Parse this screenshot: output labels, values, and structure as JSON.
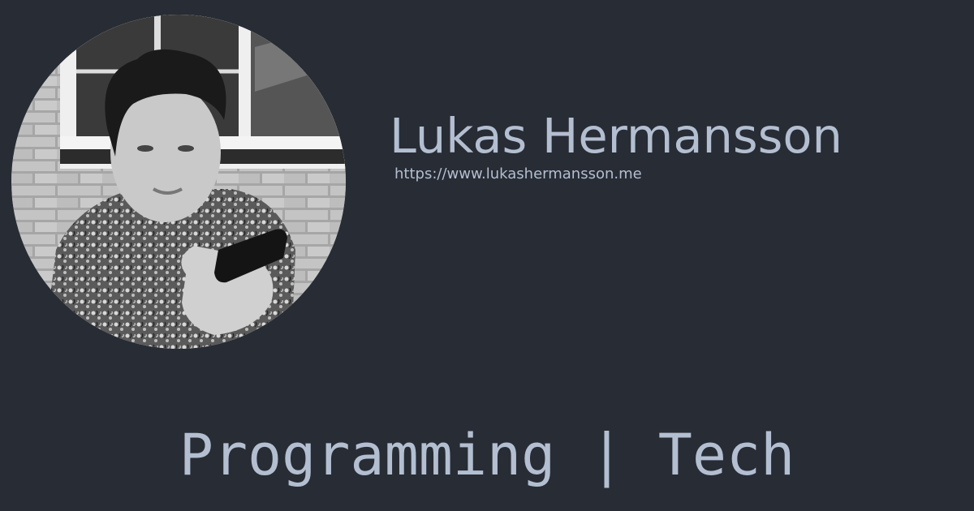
{
  "profile": {
    "name": "Lukas Hermansson",
    "url": "https://www.lukashermansson.me",
    "photo": "black-and-white-portrait"
  },
  "tagline": "Programming | Tech",
  "colors": {
    "background": "#282c34",
    "text": "#b3bfd1"
  }
}
